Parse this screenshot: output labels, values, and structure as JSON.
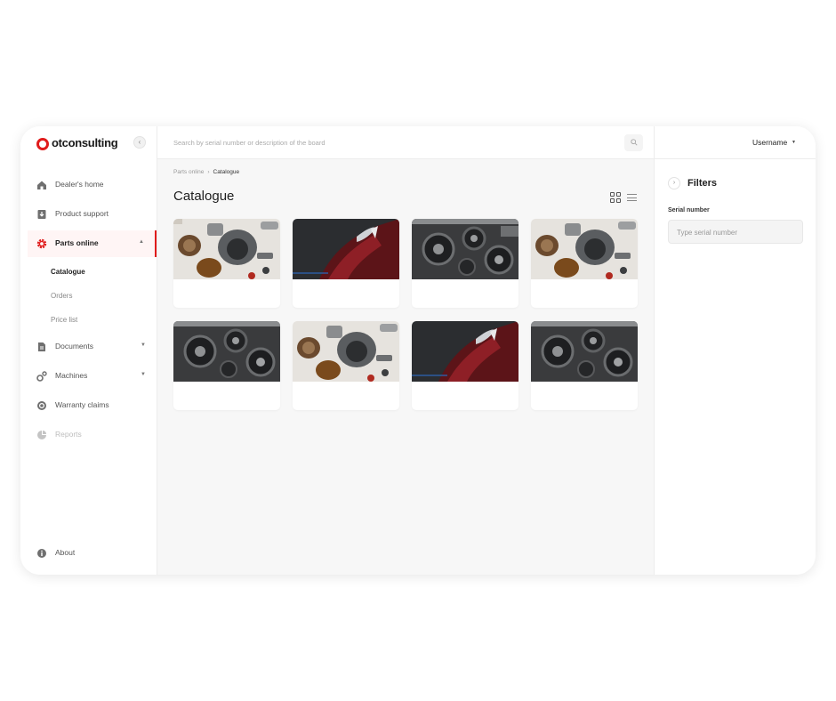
{
  "app": {
    "brand": "otconsulting"
  },
  "sidebar": {
    "items": [
      {
        "label": "Dealer's home",
        "icon": "home-icon"
      },
      {
        "label": "Product support",
        "icon": "download-icon"
      },
      {
        "label": "Parts online",
        "icon": "gear-icon",
        "active": true
      },
      {
        "label": "Documents",
        "icon": "document-icon"
      },
      {
        "label": "Machines",
        "icon": "machines-icon"
      },
      {
        "label": "Warranty claims",
        "icon": "warranty-icon"
      },
      {
        "label": "Reports",
        "icon": "pie-chart-icon",
        "disabled": true
      }
    ],
    "subitems": [
      {
        "label": "Catalogue",
        "active": true
      },
      {
        "label": "Orders"
      },
      {
        "label": "Price list"
      }
    ],
    "footer": {
      "label": "About",
      "icon": "info-icon"
    }
  },
  "topbar": {
    "search_placeholder": "Search by serial number or description of the board",
    "username": "Username"
  },
  "main": {
    "breadcrumb": [
      "Parts online",
      "Catalogue"
    ],
    "title": "Catalogue",
    "cards": [
      {
        "image": "parts-spread"
      },
      {
        "image": "red-car"
      },
      {
        "image": "engine"
      },
      {
        "image": "parts-spread"
      },
      {
        "image": "engine"
      },
      {
        "image": "parts-spread"
      },
      {
        "image": "red-car"
      },
      {
        "image": "engine"
      }
    ]
  },
  "filters": {
    "title": "Filters",
    "serial_label": "Serial number",
    "serial_placeholder": "Type serial number"
  },
  "colors": {
    "accent": "#e01b1b",
    "main_bg": "#f7f7f7"
  }
}
